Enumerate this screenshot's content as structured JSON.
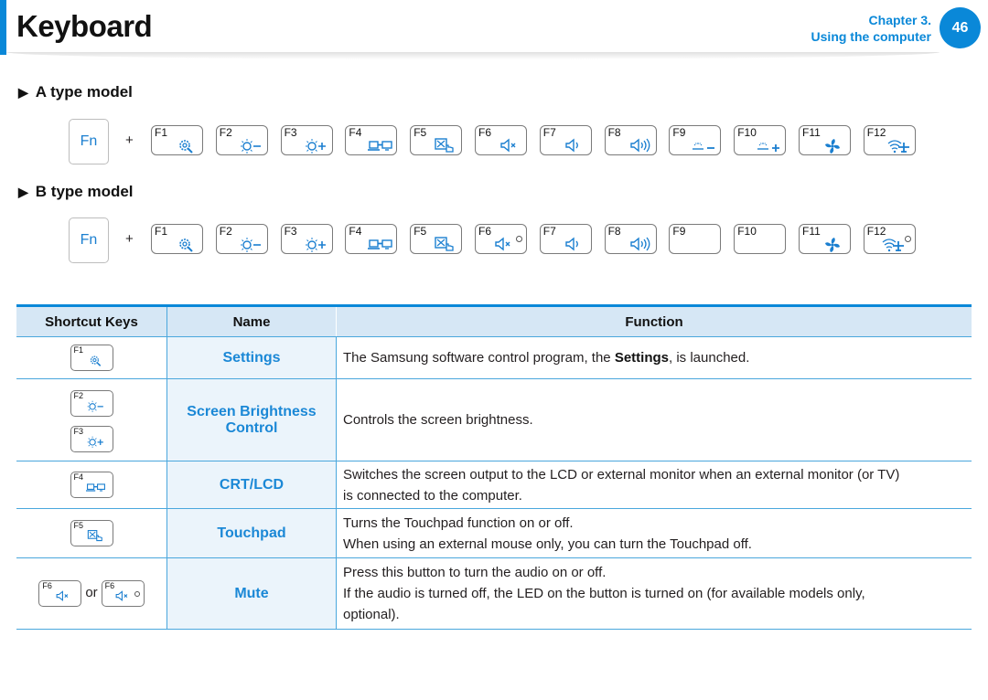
{
  "header": {
    "title": "Keyboard",
    "chapter_line1": "Chapter 3.",
    "chapter_line2": "Using the computer",
    "page_number": "46",
    "accent_color": "#0a88d8"
  },
  "sections": [
    {
      "heading": "A type model",
      "fn_label": "Fn",
      "plus": "+",
      "keys": [
        {
          "label": "F1",
          "icon": "settings-icon"
        },
        {
          "label": "F2",
          "icon": "brightness-down-icon"
        },
        {
          "label": "F3",
          "icon": "brightness-up-icon"
        },
        {
          "label": "F4",
          "icon": "crt-lcd-icon"
        },
        {
          "label": "F5",
          "icon": "touchpad-icon"
        },
        {
          "label": "F6",
          "icon": "mute-icon"
        },
        {
          "label": "F7",
          "icon": "volume-down-icon"
        },
        {
          "label": "F8",
          "icon": "volume-up-icon"
        },
        {
          "label": "F9",
          "icon": "keyboard-backlight-down-icon"
        },
        {
          "label": "F10",
          "icon": "keyboard-backlight-up-icon"
        },
        {
          "label": "F11",
          "icon": "fan-icon"
        },
        {
          "label": "F12",
          "icon": "wifi-airplane-icon"
        }
      ]
    },
    {
      "heading": "B type model",
      "fn_label": "Fn",
      "plus": "+",
      "keys": [
        {
          "label": "F1",
          "icon": "settings-icon"
        },
        {
          "label": "F2",
          "icon": "brightness-down-icon"
        },
        {
          "label": "F3",
          "icon": "brightness-up-icon"
        },
        {
          "label": "F4",
          "icon": "crt-lcd-icon"
        },
        {
          "label": "F5",
          "icon": "touchpad-icon"
        },
        {
          "label": "F6",
          "icon": "mute-icon",
          "led": true
        },
        {
          "label": "F7",
          "icon": "volume-down-icon"
        },
        {
          "label": "F8",
          "icon": "volume-up-icon"
        },
        {
          "label": "F9",
          "icon": ""
        },
        {
          "label": "F10",
          "icon": ""
        },
        {
          "label": "F11",
          "icon": "fan-icon"
        },
        {
          "label": "F12",
          "icon": "wifi-airplane-icon",
          "led": true
        }
      ]
    }
  ],
  "table": {
    "headers": [
      "Shortcut Keys",
      "Name",
      "Function"
    ],
    "rows": [
      {
        "keys": [
          {
            "label": "F1",
            "icon": "settings-icon"
          }
        ],
        "name": "Settings",
        "func_pre": "The Samsung software control program, the ",
        "func_bold": "Settings",
        "func_post": ", is launched."
      },
      {
        "keys": [
          {
            "label": "F2",
            "icon": "brightness-down-icon"
          },
          {
            "label": "F3",
            "icon": "brightness-up-icon"
          }
        ],
        "name_line1": "Screen Brightness",
        "name_line2": "Control",
        "func": "Controls the screen brightness."
      },
      {
        "keys": [
          {
            "label": "F4",
            "icon": "crt-lcd-icon"
          }
        ],
        "name": "CRT/LCD",
        "func_line1": "Switches the screen output to the LCD or external monitor when an external monitor (or TV)",
        "func_line2": "is connected to the computer."
      },
      {
        "keys": [
          {
            "label": "F5",
            "icon": "touchpad-icon"
          }
        ],
        "name": "Touchpad",
        "func_line1": "Turns the Touchpad function on or off.",
        "func_line2": "When using an external mouse only, you can turn the Touchpad off."
      },
      {
        "keys": [
          {
            "label": "F6",
            "icon": "mute-icon"
          },
          {
            "label": "F6",
            "icon": "mute-icon",
            "led": true
          }
        ],
        "or_text": "or",
        "name": "Mute",
        "func_line1": "Press this button to turn the audio on or off.",
        "func_line2": "If the audio is turned off, the LED on the button is turned on (for available models only,",
        "func_line3": "optional)."
      }
    ]
  }
}
